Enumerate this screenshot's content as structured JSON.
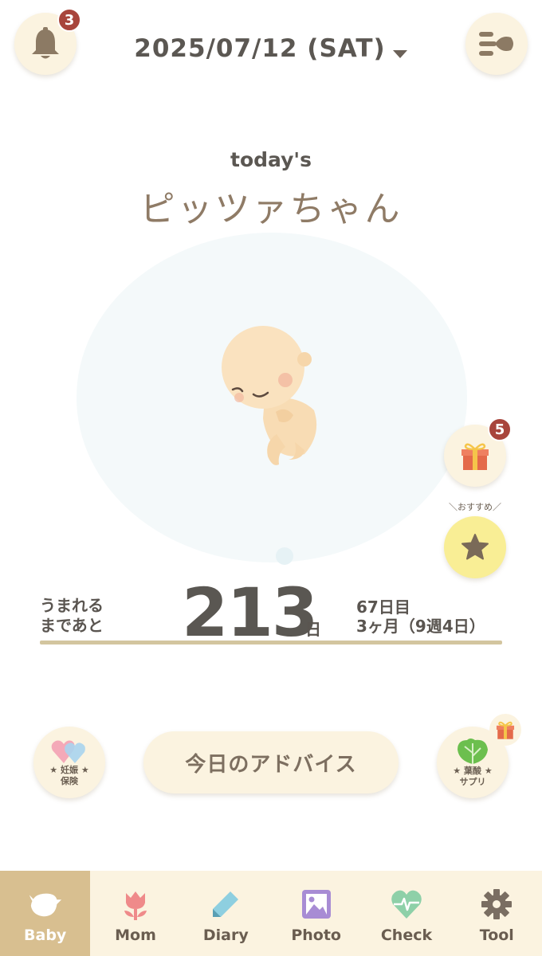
{
  "header": {
    "notification_count": "3",
    "date": "2025/07/12 (SAT)",
    "bell_icon": "bell-icon",
    "menu_icon": "menu-icon"
  },
  "hero": {
    "todays": "today's",
    "baby_name": "ピッツァちゃん"
  },
  "side_actions": {
    "gift_count": "5",
    "recommend_label": "＼おすすめ／"
  },
  "countdown": {
    "label_line1": "うまれる",
    "label_line2": "まであと",
    "days_remaining": "213",
    "unit": "日",
    "day_of_pregnancy": "67日目",
    "month_week": "3ヶ月（9週4日）"
  },
  "actions": {
    "insurance_line1": "★ 妊娠 ★",
    "insurance_line2": "保険",
    "advice": "今日のアドバイス",
    "folic_line1": "★ 葉酸 ★",
    "folic_line2": "サプリ"
  },
  "tabs": [
    {
      "label": "Baby",
      "icon": "bird-icon"
    },
    {
      "label": "Mom",
      "icon": "tulip-icon"
    },
    {
      "label": "Diary",
      "icon": "pencil-icon"
    },
    {
      "label": "Photo",
      "icon": "photo-icon"
    },
    {
      "label": "Check",
      "icon": "heart-pulse-icon"
    },
    {
      "label": "Tool",
      "icon": "gear-icon"
    }
  ],
  "colors": {
    "accent_cream": "#fbf3e0",
    "active_tab": "#d8bf90",
    "badge": "#a8453c",
    "underline": "#d3c59f"
  }
}
